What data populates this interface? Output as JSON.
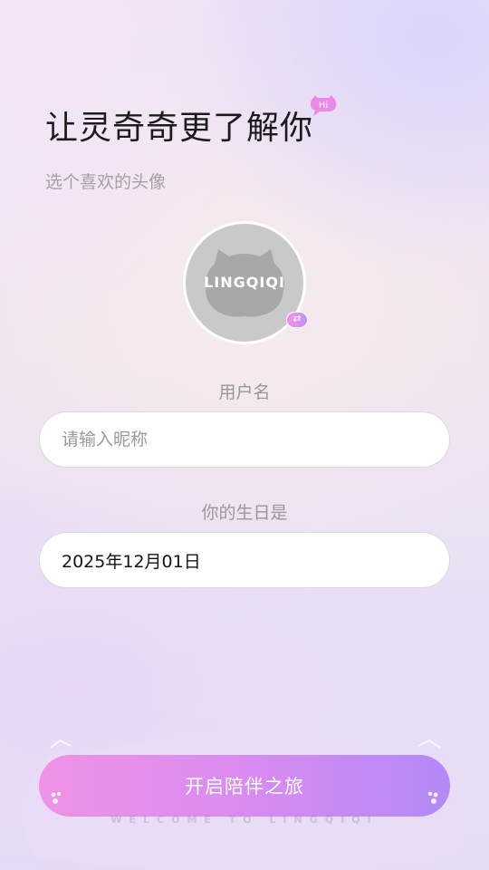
{
  "header": {
    "title": "让灵奇奇更了解你",
    "hi_badge": "Hi",
    "subtitle": "选个喜欢的头像"
  },
  "avatar": {
    "logo_text": "LINGQIQI",
    "swap_icon": "⇄"
  },
  "form": {
    "username_label": "用户名",
    "nickname_placeholder": "请输入昵称",
    "nickname_value": "",
    "birthday_label": "你的生日是",
    "birthday_value": "2025年12月01日"
  },
  "footer": {
    "start_button_label": "开启陪伴之旅",
    "welcome_text": "WELCOME TO LINGQIQI"
  },
  "colors": {
    "button_start": "#ef93e6",
    "button_end": "#b28af6",
    "badge": "#e98ae8"
  }
}
